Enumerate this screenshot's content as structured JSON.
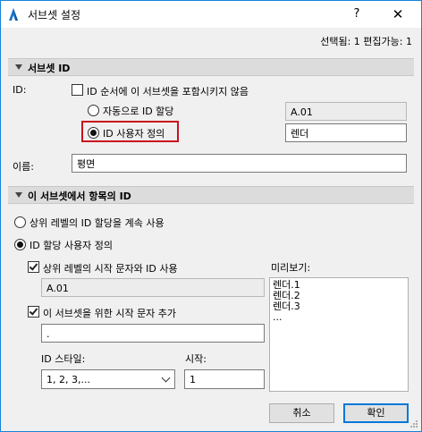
{
  "window": {
    "title": "서브셋 설정",
    "help": "?",
    "close": "✕"
  },
  "header": {
    "status": "선택됨: 1 편집가능: 1"
  },
  "section1": {
    "title": "서브셋 ID",
    "id_label": "ID:",
    "include_checkbox": {
      "label": "ID 순서에 이 서브셋을 포함시키지 않음",
      "checked": false
    },
    "auto_radio": {
      "label": "자동으로 ID 할당",
      "selected": false
    },
    "auto_value": "A.01",
    "custom_radio": {
      "label": "ID 사용자 정의",
      "selected": true
    },
    "custom_value": "렌더",
    "name_label": "이름:",
    "name_value": "평면"
  },
  "section2": {
    "title": "이 서브셋에서 항목의 ID",
    "continue_radio": {
      "label": "상위 레벨의 ID 할당을 계속 사용",
      "selected": false
    },
    "custom_radio": {
      "label": "ID 할당 사용자 정의",
      "selected": true
    },
    "use_parent_checkbox": {
      "label": "상위 레벨의 시작 문자와 ID 사용",
      "checked": true
    },
    "parent_value": "A.01",
    "add_prefix_checkbox": {
      "label": "이 서브셋을 위한 시작 문자 추가",
      "checked": true
    },
    "prefix_value": ".",
    "style_label": "ID 스타일:",
    "style_value": "1, 2, 3,...",
    "start_label": "시작:",
    "start_value": "1",
    "preview_label": "미리보기:",
    "preview_items": [
      "렌더.1",
      "렌더.2",
      "렌더.3",
      "..."
    ]
  },
  "buttons": {
    "cancel": "취소",
    "ok": "확인"
  }
}
